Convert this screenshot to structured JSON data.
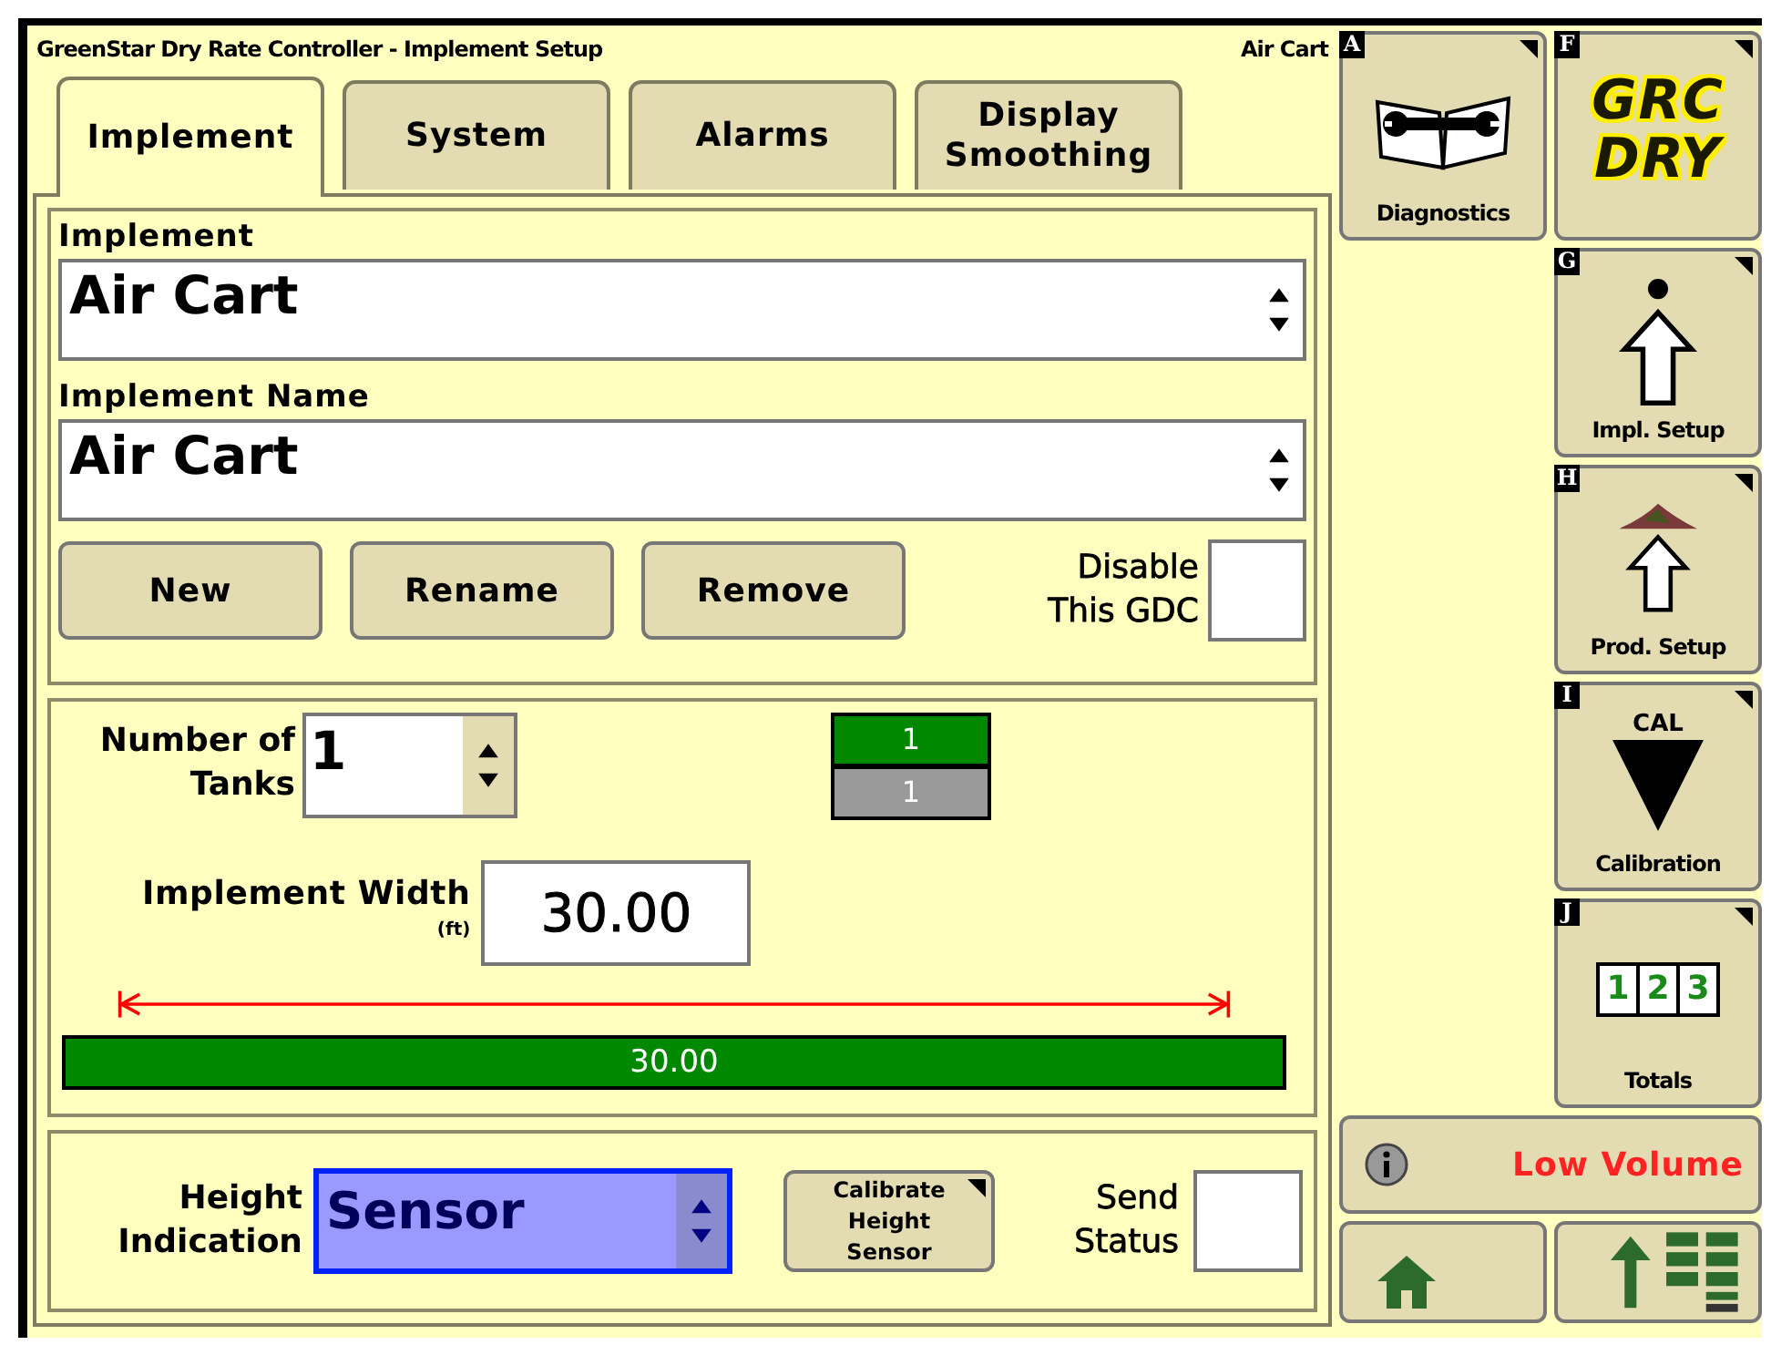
{
  "window": {
    "title": "GreenStar Dry Rate Controller - Implement Setup",
    "context": "Air Cart"
  },
  "tabs": [
    {
      "label": "Implement",
      "selected": true
    },
    {
      "label": "System",
      "selected": false
    },
    {
      "label": "Alarms",
      "selected": false
    },
    {
      "label": "Display Smoothing",
      "selected": false
    }
  ],
  "implement_section": {
    "fields": [
      {
        "label": "Implement",
        "value": "Air Cart"
      },
      {
        "label": "Implement Name",
        "value": "Air Cart"
      }
    ],
    "buttons": [
      "New",
      "Rename",
      "Remove"
    ],
    "disable_checkbox": {
      "label": "Disable This GDC",
      "checked": false
    }
  },
  "tanks": {
    "label": "Number of Tanks",
    "value": "1",
    "indicator": [
      {
        "label": "1",
        "color": "#008800"
      },
      {
        "label": "1",
        "color": "#999999"
      }
    ]
  },
  "width": {
    "label": "Implement Width",
    "unit": "(ft)",
    "value": "30.00",
    "bar_label": "30.00"
  },
  "height": {
    "label": "Height Indication",
    "value": "Sensor",
    "calibrate_button": "Calibrate Height Sensor",
    "send_status": {
      "label": "Send Status",
      "checked": false
    }
  },
  "softkeys": [
    {
      "kind": "diagnostics",
      "letter": "A",
      "label": "Diagnostics"
    },
    {
      "kind": "logo",
      "letter": "F",
      "label": "GRC DRY"
    },
    {
      "kind": "impl",
      "letter": "G",
      "label": "Impl. Setup"
    },
    {
      "kind": "prod",
      "letter": "H",
      "label": "Prod. Setup"
    },
    {
      "kind": "cal",
      "letter": "I",
      "label": "Calibration",
      "caption": "CAL"
    },
    {
      "kind": "totals",
      "letter": "J",
      "label": "Totals",
      "digits": [
        "1",
        "2",
        "3"
      ]
    }
  ],
  "alarm": {
    "message": "Low Volume"
  }
}
